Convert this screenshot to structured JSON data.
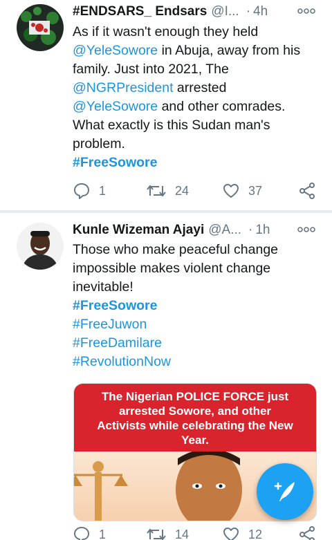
{
  "tweets": [
    {
      "display_name": "#ENDSARS_ Endsars",
      "handle": "@I...",
      "separator": "·",
      "time": "4h",
      "body_lines": [
        [
          "As if it wasn't enough they held"
        ],
        [
          "@YeleSowore",
          " in Abuja, away from his"
        ],
        [
          "family. Just into 2021, The"
        ],
        [
          "@NGRPresident",
          " arrested"
        ],
        [
          "@YeleSowore",
          " and other comrades."
        ],
        [
          "What exactly is this Sudan man's"
        ],
        [
          "problem."
        ]
      ],
      "hashtags": [
        "#FreeSowore"
      ],
      "replies": "1",
      "retweets": "24",
      "likes": "37"
    },
    {
      "display_name": "Kunle Wizeman Ajayi",
      "handle": "@A...",
      "separator": "·",
      "time": "1h",
      "body_lines": [
        "Those who make peaceful change",
        "impossible makes violent change",
        "inevitable!"
      ],
      "hashtags": [
        "#FreeSowore",
        "#FreeJuwon",
        "#FreeDamilare",
        "#RevolutionNow"
      ],
      "media": {
        "banner_lines": [
          "The Nigerian POLICE FORCE just",
          "arrested Sowore, and other",
          "Activists while celebrating the New",
          "Year."
        ]
      },
      "replies": "1",
      "retweets": "14",
      "likes": "12"
    }
  ],
  "icons": {
    "reply": "reply-icon",
    "retweet": "retweet-icon",
    "like": "heart-icon",
    "share": "share-icon",
    "more": "more-options-icon",
    "compose": "compose-tweet-icon"
  },
  "colors": {
    "link": "#1b95e0",
    "muted": "#657786",
    "fab": "#1da1f2",
    "banner": "#d9232d"
  }
}
